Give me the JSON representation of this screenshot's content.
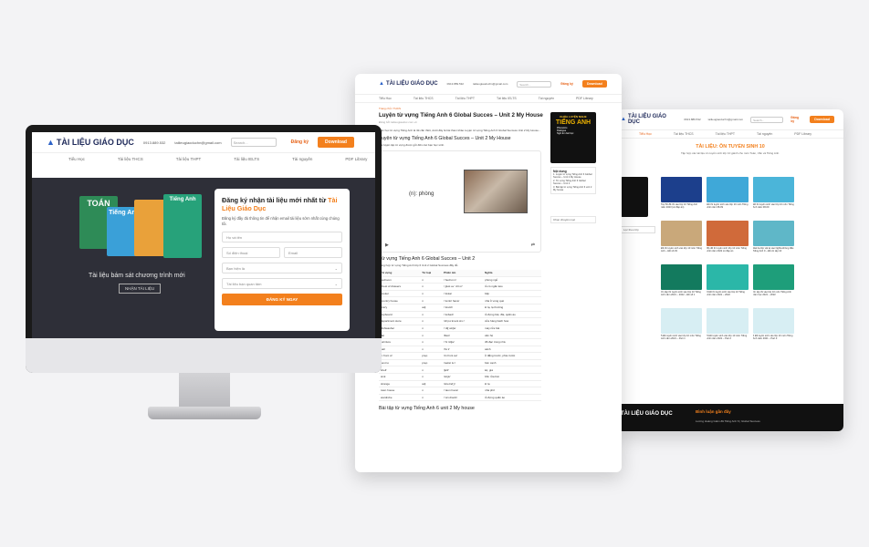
{
  "site": {
    "logo_text": "TÀI LIỆU GIÁO DỤC",
    "phone": "0913.889.532",
    "email": "tailieugiaoduchn@gmail.com",
    "search_placeholder": "Search...",
    "login_label": "Đăng ký",
    "download_label": "Download",
    "nav": [
      "Tiểu Học",
      "Tài liệu THCS",
      "Tài liệu THPT",
      "Tài liệu IELTS",
      "Tài nguyên",
      "PDF Library"
    ]
  },
  "monitor": {
    "hero_caption": "Tài liệu bám sát chương trình mới",
    "hero_button": "NHẬN TÀI LIỆU",
    "books": [
      "TOÁN",
      "Tiếng Anh",
      "Tiếng Anh"
    ],
    "form": {
      "title_part1": "Đăng ký nhận tài liệu mới nhất từ ",
      "title_highlight": "Tài Liệu Giáo Dục",
      "subtitle": "Đăng ký đầy đủ thông tin để nhận email tài liệu sớm nhất cùng chúng tôi.",
      "name_placeholder": "Họ và tên",
      "phone_placeholder": "Số điện thoại",
      "email_placeholder": "Email",
      "role_select": "Bạn hiện là",
      "interest_select": "Tài liệu bạn quan tâm",
      "submit_label": "ĐĂNG KÝ NGAY"
    }
  },
  "article": {
    "crumb": "Trang chủ / THCS",
    "title": "Luyện từ vựng Tiếng Anh 6 Global Succes – Unit 2 My House",
    "meta": "Đăng bởi tailieugiaoduc.com.vn",
    "intro": "Việc học từ vựng Tiếng Anh là rất cần thiết, dưới đây là bài tham khảo Luyện từ vựng Tiếng Anh 6 Global Success Unit 2 My House...",
    "section1": "Luyện từ vựng Tiếng Anh 6 Global Succes – Unit 2 My House",
    "section1_note": "Bài luyện tập từ vựng được gửi đến các bạn học sinh.",
    "player_word": "(n): phòng",
    "section2": "Từ vựng Tiếng Anh 6 Global Succes – Unit 2",
    "section2_note": "Tổng hợp từ vựng Tiếng Anh lớp 6 Unit 2 Global Success đầy đủ.",
    "table_headers": [
      "Từ vựng",
      "Từ loại",
      "Phiên âm",
      "Nghĩa"
    ],
    "table_rows": [
      [
        "bedroom",
        "n",
        "/ˈbedruːm/",
        "phòng ngủ"
      ],
      [
        "chest of drawers",
        "n",
        "/ˌtʃest əv ˈdrɔːz/",
        "tủ có ngăn kéo"
      ],
      [
        "cooker",
        "n",
        "/ˈkʊkə/",
        "bếp"
      ],
      [
        "country house",
        "n",
        "/ˈkʌntri haʊs/",
        "nhà ở vùng quê"
      ],
      [
        "crazy",
        "adj",
        "/ˈkreɪzi/",
        "kì lạ, lạ thường"
      ],
      [
        "cupboard",
        "n",
        "/ˈkʌbəd/",
        "tủ đựng bát, đĩa, quần áo"
      ],
      [
        "department store",
        "n",
        "/dɪˈpɑːtmənt stɔː/",
        "cửa hàng bách hoá"
      ],
      [
        "dishwasher",
        "n",
        "/ˈdɪʃˌwɒʃə/",
        "máy rửa bát"
      ],
      [
        "flat",
        "n",
        "/flæt/",
        "căn hộ"
      ],
      [
        "furniture",
        "n",
        "/ˈfɜːnɪtʃə/",
        "đồ đạc trong nhà"
      ],
      [
        "hall",
        "n",
        "/hɔːl/",
        "sảnh"
      ],
      [
        "in front of",
        "prep",
        "/ɪn frʌnt əv/",
        "ở đằng trước, phía trước"
      ],
      [
        "next to",
        "prep",
        "/nekst tuː/",
        "bên cạnh"
      ],
      [
        "shelf",
        "n",
        "/ʃelf/",
        "kệ, giá"
      ],
      [
        "sink",
        "n",
        "/sɪŋk/",
        "bồn rửa bát"
      ],
      [
        "strange",
        "adj",
        "/streɪndʒ/",
        "kì lạ"
      ],
      [
        "town house",
        "n",
        "/ˈtaʊn haʊs/",
        "nhà phố"
      ],
      [
        "wardrobe",
        "n",
        "/ˈwɔːdrəʊb/",
        "tủ đựng quần áo"
      ]
    ],
    "section3": "Bài tập từ vựng Tiếng Anh 6 unit 2 My house",
    "side_ad_top": "KHÓA LUYỆN NGHE",
    "side_ad_big": "TIẾNG ANH",
    "side_ad_items": [
      "Phonetics",
      "Dialogue",
      "Ngữ âm bài học"
    ],
    "toc_title": "Nội dung",
    "toc_items": [
      "1. Luyện từ vựng Tiếng Anh 6 Global Succes – Unit 2 My House",
      "2. Từ vựng Tiếng Anh 6 Global Succes – Unit 2",
      "3. Bài tập từ vựng Tiếng Anh 6 unit 2 My house"
    ],
    "toc_select": "Chọn chuyên mục"
  },
  "listing": {
    "section_title": "TÀI LIỆU: ÔN TUYỂN SINH 10",
    "section_sub": "Tập hợp các tài liệu ôn tuyển sinh lớp 10 giành cho môn Toán, Văn và Tiếng Anh.",
    "filter_label": "Lọc theo lớp",
    "cards": [
      {
        "caption": "Top 50 đề thi vào lớp 10 Tiếng Anh năm 2023 (có đáp án)",
        "color": "#1c3f8c"
      },
      {
        "caption": "Đề thi tuyển sinh vào lớp 10 môn Tiếng Anh năm 08-09",
        "color": "#3fa8d8"
      },
      {
        "caption": "Đề thi tuyển sinh vào lớp 10 môn Tiếng Anh năm 08-09",
        "color": "#4bb5d9"
      },
      {
        "caption": "Đề thi tuyển sinh vào lớp 10 môn Tiếng Anh – Đề số 03",
        "color": "#c9a87a"
      },
      {
        "caption": "Bộ đề thi tuyển sinh lớp 10 môn Tiếng Anh năm 2022 có đáp án",
        "color": "#d06a3a"
      },
      {
        "caption": "Wal ba lớp vật lạ vào Nghĩa không đầu Tiếng Anh 9 – Đề ôn tập 10",
        "color": "#5fb7c8"
      },
      {
        "caption": "Ôn tập thi tuyển sinh vào lớp 10 Tiếng Anh năm 2021 – 2022 – Đề số 1",
        "color": "#137a5e"
      },
      {
        "caption": "6 Đề thi tuyển sinh vào lớp 10 Tiếng Anh năm 2021 – 2022",
        "color": "#2bb7a8"
      },
      {
        "caption": "Ôn tập thi vào lớp 10 môn Tiếng Anh năm học 2021 – 2022",
        "color": "#1e9e7a"
      },
      {
        "caption": "5 Đề tuyển sinh vào lớp 10 môn Tiếng Anh năm 2021 – Part 1",
        "color": "#d7eef3"
      },
      {
        "caption": "5 Đề tuyển sinh vào lớp 10 môn Tiếng Anh năm 2021 – Part 2",
        "color": "#d7eef3"
      },
      {
        "caption": "5 Đề tuyển sinh vào lớp 10 môn Tiếng Anh năm 2021 – Part 3",
        "color": "#d7eef3"
      }
    ],
    "footer_title": "Bình luận gần đây",
    "footer_item": "Lương Hoàng Giám đã Tiếng Anh 6 | Global Success",
    "footer_logo": "TÀI LIỆU GIÁO DỤC"
  }
}
